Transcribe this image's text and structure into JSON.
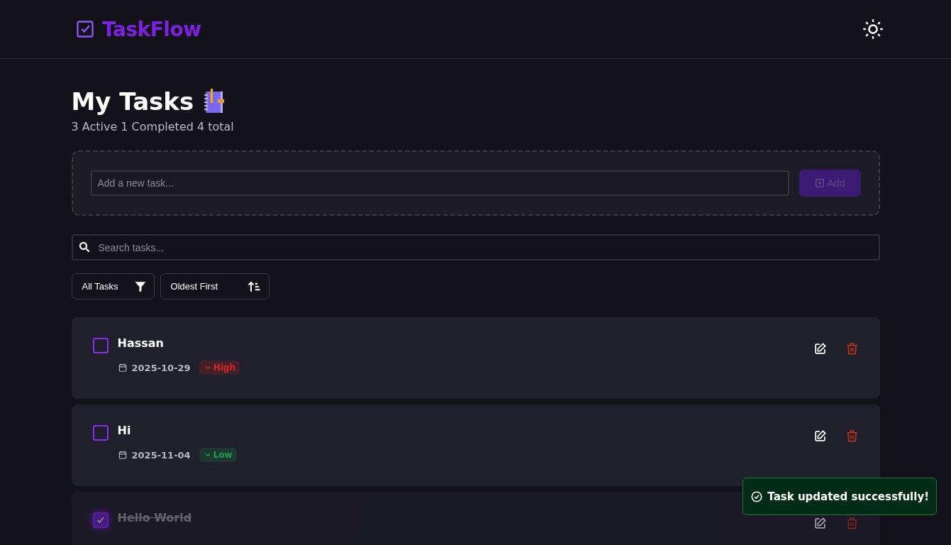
{
  "brand": {
    "name": "TaskFlow"
  },
  "page": {
    "title": "My Tasks",
    "summary": "3 Active 1 Completed 4 total"
  },
  "new_task": {
    "placeholder": "Add a new task...",
    "button": "Add",
    "disabled": true
  },
  "search": {
    "placeholder": "Search tasks..."
  },
  "filters": [
    {
      "label": "All Tasks",
      "kind": "filter"
    },
    {
      "label": "Oldest First",
      "kind": "sort"
    }
  ],
  "tasks": [
    {
      "title": "Hassan",
      "checked": false,
      "date": "2025-10-29",
      "priority": {
        "label": "High",
        "color": "#dc2626"
      }
    },
    {
      "title": "Hi",
      "checked": false,
      "date": "2025-11-04",
      "priority": {
        "label": "Low",
        "color": "#16a34a"
      }
    },
    {
      "title": "Hello World",
      "checked": true
    }
  ],
  "toast": {
    "message": "Task updated successfully!",
    "kind": "success"
  }
}
